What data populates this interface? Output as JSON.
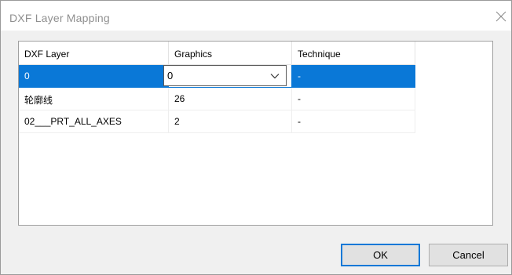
{
  "dialog": {
    "title": "DXF Layer Mapping"
  },
  "colors": {
    "selection": "#0a78d7",
    "default_button_border": "#0a78d7"
  },
  "icons": {
    "close": "close-icon",
    "dropdown": "chevron-down-icon"
  },
  "grid": {
    "columns": [
      "DXF Layer",
      "Graphics",
      "Technique"
    ],
    "rows": [
      {
        "layer": "0",
        "graphics": "0",
        "technique": "-",
        "selected": true,
        "editing_column": "graphics"
      },
      {
        "layer": "轮廓线",
        "graphics": "26",
        "technique": "-"
      },
      {
        "layer": "02___PRT_ALL_AXES",
        "graphics": "2",
        "technique": "-"
      }
    ]
  },
  "buttons": {
    "ok": "OK",
    "cancel": "Cancel"
  }
}
